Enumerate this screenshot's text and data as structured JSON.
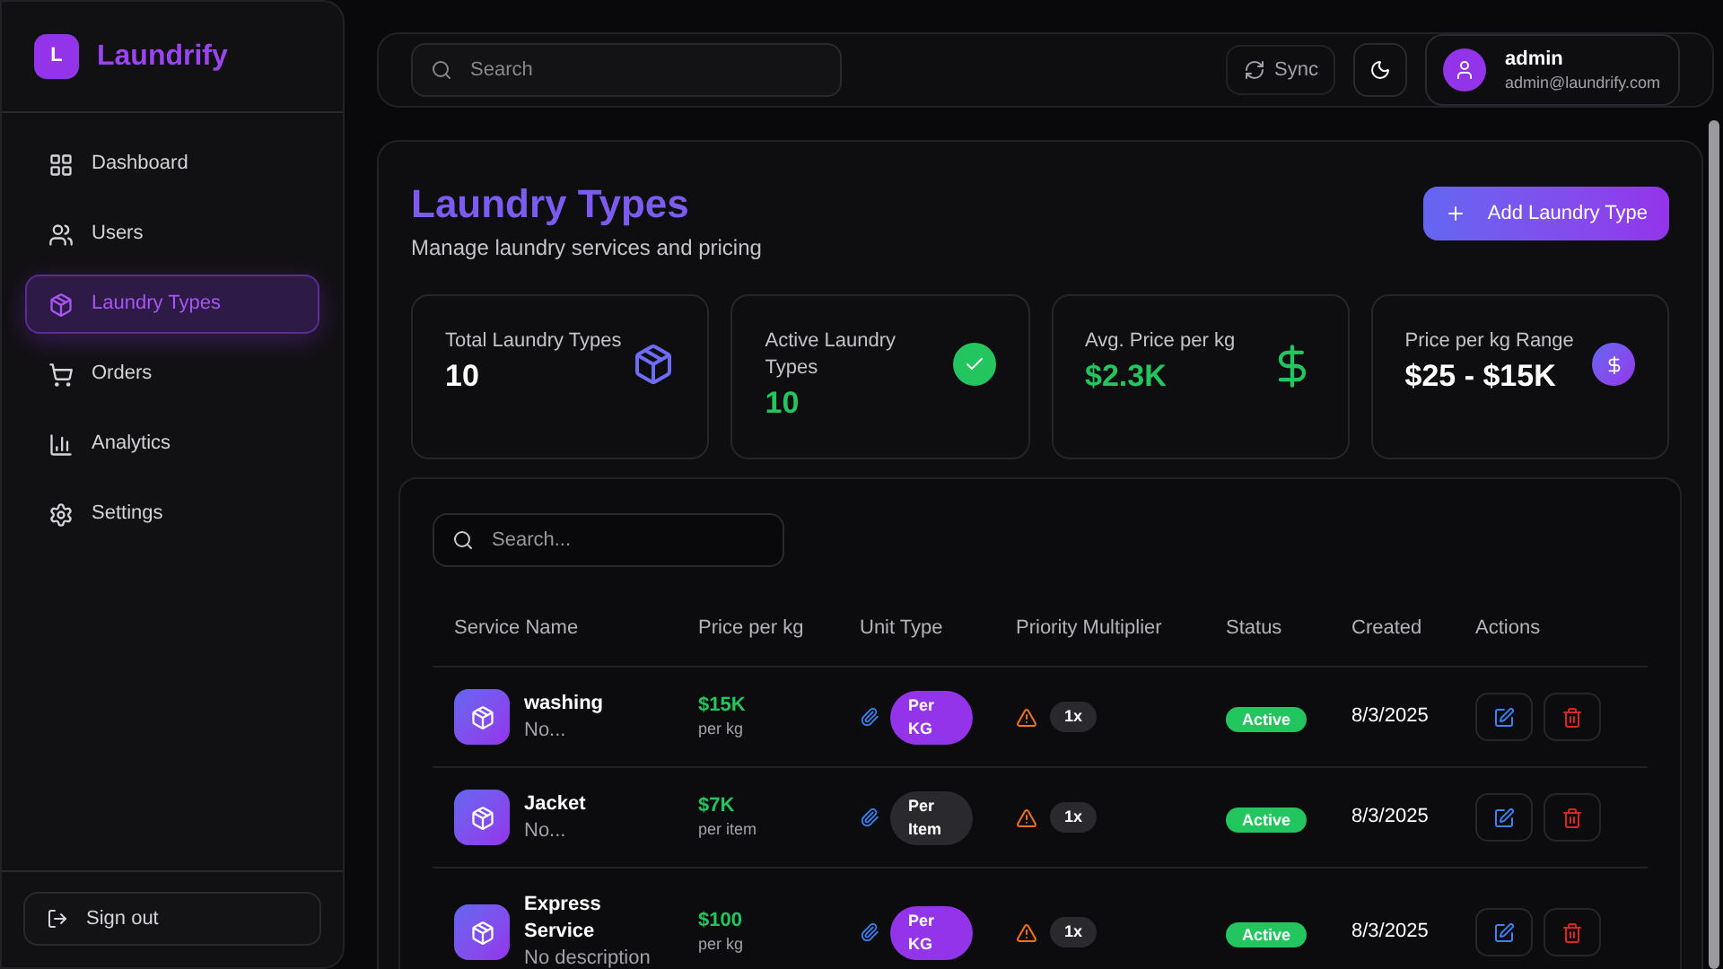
{
  "brand": {
    "logo_letter": "L",
    "name": "Laundrify"
  },
  "sidebar": {
    "items": [
      {
        "label": "Dashboard",
        "selected": false
      },
      {
        "label": "Users",
        "selected": false
      },
      {
        "label": "Laundry Types",
        "selected": true
      },
      {
        "label": "Orders",
        "selected": false
      },
      {
        "label": "Analytics",
        "selected": false
      },
      {
        "label": "Settings",
        "selected": false
      }
    ],
    "sign_out": "Sign out"
  },
  "topbar": {
    "search_placeholder": "Search",
    "sync": "Sync",
    "user": {
      "name": "admin",
      "email": "admin@laundrify.com"
    }
  },
  "page": {
    "title": "Laundry Types",
    "subtitle": "Manage laundry services and pricing",
    "add_button": "Add Laundry Type"
  },
  "stats": [
    {
      "label": "Total Laundry Types",
      "value": "10",
      "kind": "box"
    },
    {
      "label": "Active Laundry Types",
      "value": "10",
      "kind": "check"
    },
    {
      "label": "Avg. Price per kg",
      "value": "$2.3K",
      "kind": "dollar"
    },
    {
      "label": "Price per kg Range",
      "value": "$25 - $15K",
      "kind": "range"
    }
  ],
  "table": {
    "search_placeholder": "Search...",
    "columns": [
      "Service Name",
      "Price per kg",
      "Unit Type",
      "Priority Multiplier",
      "Status",
      "Created",
      "Actions"
    ],
    "rows": [
      {
        "name": "washing",
        "description": "No...",
        "price": "$15K",
        "price_unit": "per kg",
        "unit_type": {
          "label": "Per KG",
          "color": "#9333ea"
        },
        "priority": "1x",
        "status": "Active",
        "created": "8/3/2025"
      },
      {
        "name": "Jacket",
        "description": "No...",
        "price": "$7K",
        "price_unit": "per item",
        "unit_type": {
          "label": "Per Item",
          "color": "#2a2a2e"
        },
        "priority": "1x",
        "status": "Active",
        "created": "8/3/2025"
      },
      {
        "name": "Express Service",
        "description": "No description",
        "price": "$100",
        "price_unit": "per kg",
        "unit_type": {
          "label": "Per KG",
          "color": "#9333ea"
        },
        "priority": "1x",
        "status": "Active",
        "created": "8/3/2025"
      }
    ]
  }
}
